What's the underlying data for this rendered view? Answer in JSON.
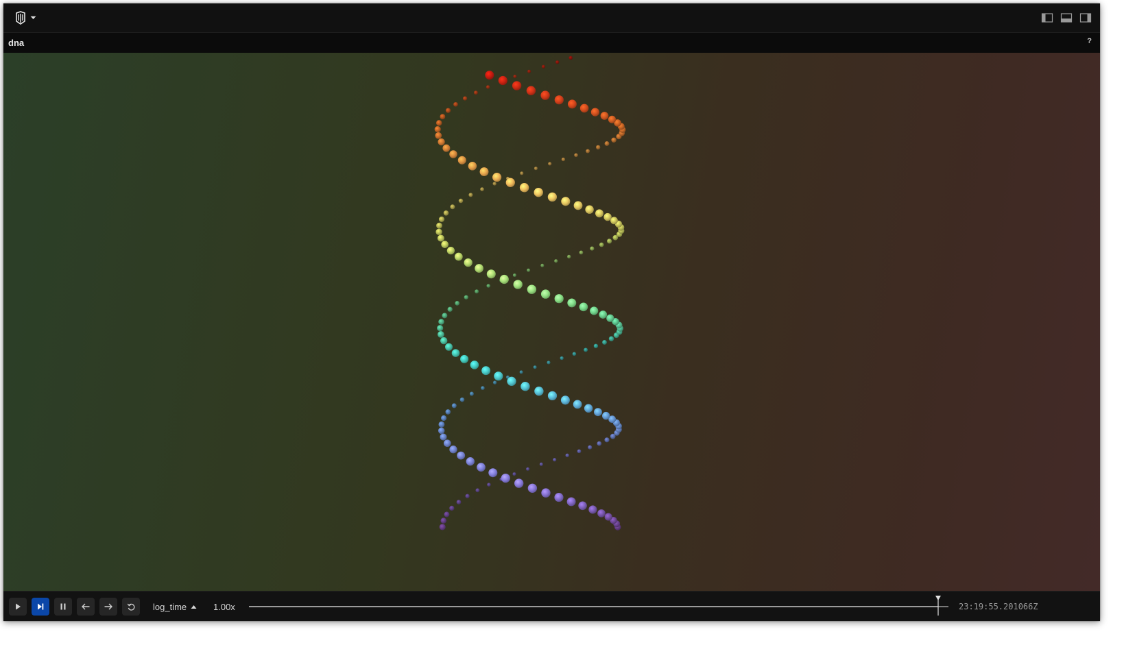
{
  "app": {
    "layout_buttons": [
      {
        "name": "toggle-left-panel",
        "icon": "left-panel-icon"
      },
      {
        "name": "toggle-bottom-panel",
        "icon": "bottom-panel-icon"
      },
      {
        "name": "toggle-right-panel",
        "icon": "right-panel-icon"
      }
    ]
  },
  "panel": {
    "title": "dna",
    "help_label": "?"
  },
  "timebar": {
    "controls": [
      {
        "name": "play-button",
        "icon": "play-icon",
        "active": false
      },
      {
        "name": "follow-button",
        "icon": "step-to-end-icon",
        "active": true
      },
      {
        "name": "pause-button",
        "icon": "pause-icon",
        "active": false
      },
      {
        "name": "step-back-button",
        "icon": "arrow-left-icon",
        "active": false
      },
      {
        "name": "step-forward-button",
        "icon": "arrow-right-icon",
        "active": false
      },
      {
        "name": "loop-button",
        "icon": "loop-icon",
        "active": false
      }
    ],
    "timeline": "log_time",
    "speed": "1.00x",
    "playhead_fraction": 0.985,
    "current_time": "23:19:55.201066Z"
  },
  "scene": {
    "type": "3d-point-helix",
    "strands": 2,
    "color_gradient": [
      "#c81c10",
      "#e8742a",
      "#f2c563",
      "#d9e66a",
      "#7fe08a",
      "#46d6c8",
      "#6fa8ea",
      "#8a7fe0",
      "#7b4aa0"
    ]
  }
}
